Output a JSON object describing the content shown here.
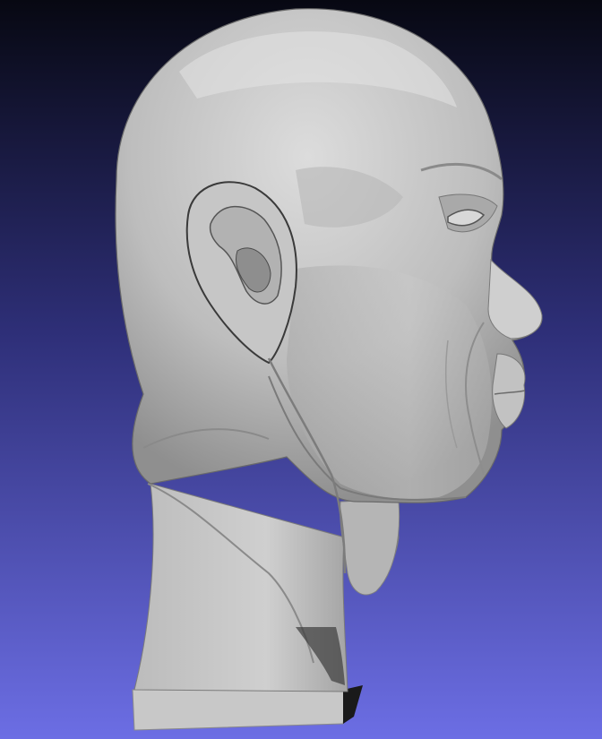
{
  "viewport": {
    "background_top": "#070812",
    "background_mid": "#2e2f78",
    "background_bottom": "#6c6ee4",
    "mesh_color": "#b9b9b9",
    "mesh_highlight": "#e4e4e4",
    "mesh_shadow": "#4a4a4a"
  },
  "model": {
    "icon": "3d-mesh-head-sculpture"
  }
}
